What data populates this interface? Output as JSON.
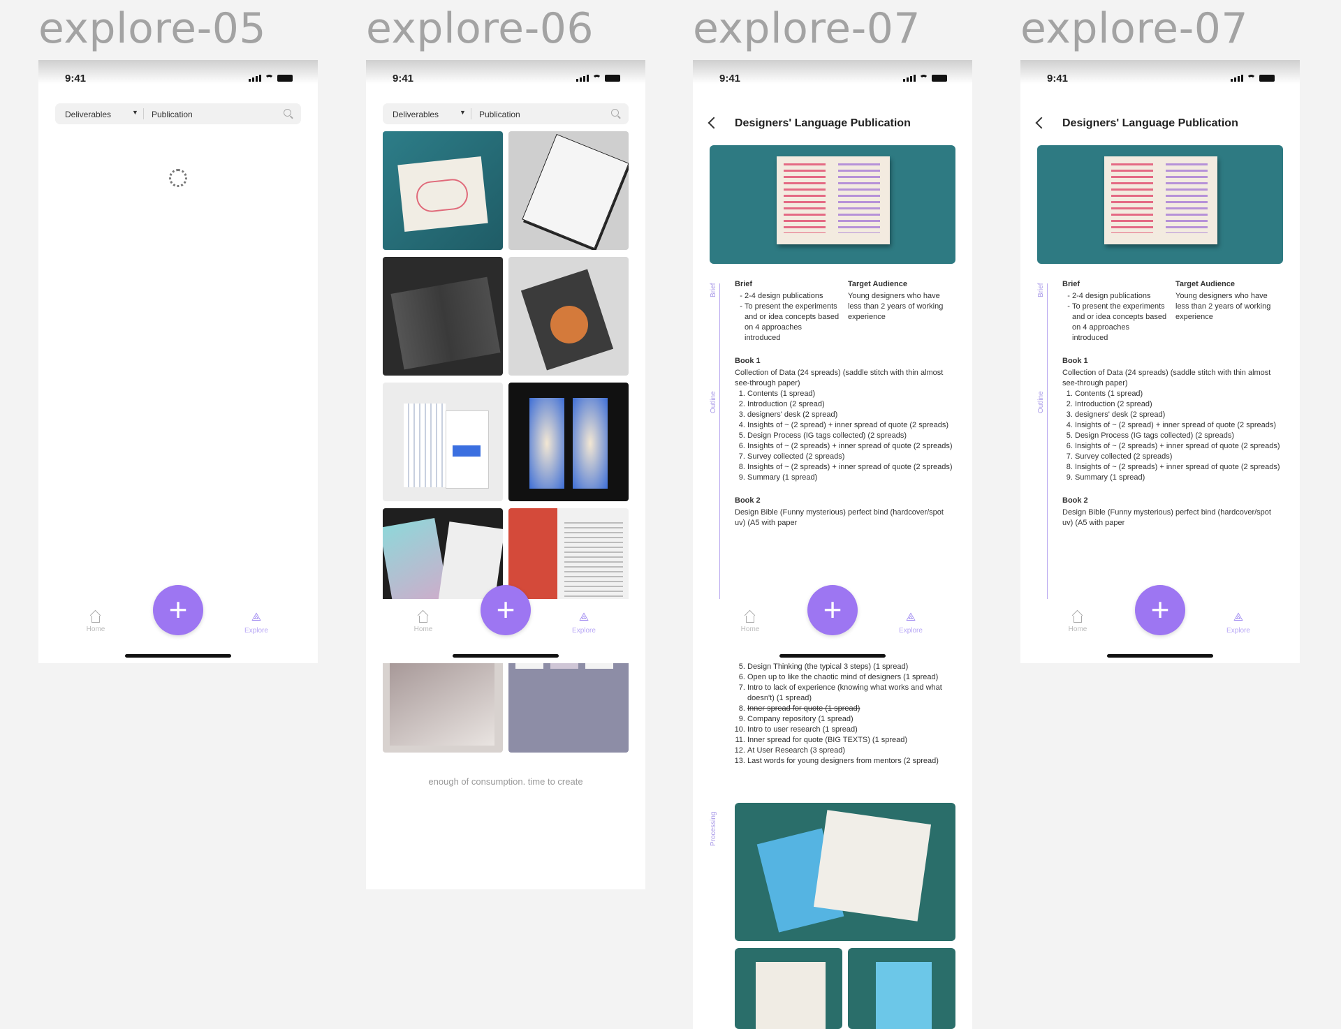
{
  "frames": [
    {
      "title": "explore-05"
    },
    {
      "title": "explore-06"
    },
    {
      "title": "explore-07"
    },
    {
      "title": "explore-07"
    }
  ],
  "status": {
    "time": "9:41"
  },
  "search": {
    "filter": "Deliverables",
    "query": "Publication"
  },
  "tabbar": {
    "home": "Home",
    "explore": "Explore",
    "fab": "+"
  },
  "grid_footer": "enough of consumption. time to create",
  "detail": {
    "title": "Designers' Language Publication",
    "side_labels": {
      "brief": "Brief",
      "outline": "Outline",
      "processing": "Processing"
    },
    "brief_heading": "Brief",
    "brief_items": [
      "2-4 design publications",
      "To present the experiments and or idea concepts based on 4 approaches introduced"
    ],
    "audience_heading": "Target Audience",
    "audience_text": "Young designers who have less than 2 years of working experience",
    "book1_heading": "Book 1",
    "book1_desc": "Collection of Data (24 spreads) (saddle stitch with thin almost see-through paper)",
    "book1_items": [
      "Contents (1 spread)",
      "Introduction (2 spread)",
      "designers' desk (2 spread)",
      "Insights of ~ (2 spread) + inner spread of quote (2 spreads)",
      "Design Process (IG tags collected) (2 spreads)",
      "Insights of ~ (2 spreads) + inner spread of quote (2 spreads)",
      "Survey collected (2 spreads)",
      "Insights of ~ (2 spreads) + inner spread of quote (2 spreads)",
      "Summary (1 spread)"
    ],
    "book2_heading": "Book 2",
    "book2_desc": "Design Bible (Funny mysterious) perfect bind (hardcover/spot uv) (A5 with paper",
    "book2_items_tail": [
      "Design Thinking (the typical 3 steps) (1 spread)",
      "Open up to like the chaotic mind of designers (1 spread)",
      "Intro to lack of experience (knowing what works and what doesn't) (1 spread)",
      "Inner spread for quote (1 spread)",
      "Company repository (1 spread)",
      "Intro to user research (1 spread)",
      "Inner spread for quote (BIG TEXTS) (1 spread)",
      "At User Research (3 spread)",
      "Last words for young designers from mentors (2 spread)"
    ]
  }
}
